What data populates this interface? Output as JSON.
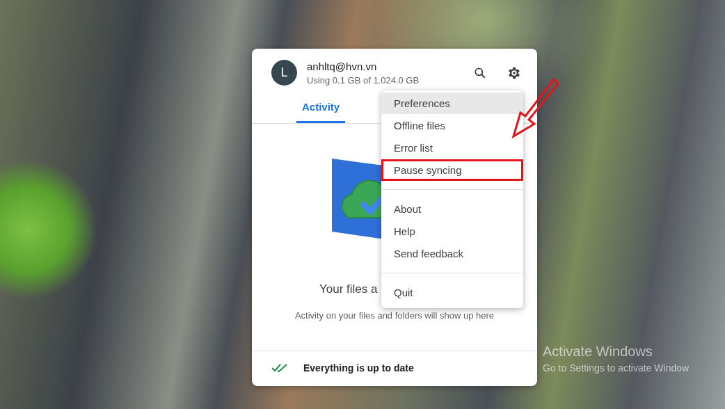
{
  "account": {
    "avatar_letter": "L",
    "email": "anhltq@hvn.vn",
    "storage": "Using 0.1 GB of 1.024.0 GB"
  },
  "tabs": [
    {
      "label": "Activity",
      "selected": true
    }
  ],
  "empty_state": {
    "title": "Your files a",
    "message": "Activity on your files and folders will show up here"
  },
  "status_bar": {
    "text": "Everything is up to date"
  },
  "menu": {
    "groups": [
      [
        {
          "label": "Preferences",
          "hovered": true,
          "annotated": false
        },
        {
          "label": "Offline files",
          "hovered": false,
          "annotated": false
        },
        {
          "label": "Error list",
          "hovered": false,
          "annotated": false
        },
        {
          "label": "Pause syncing",
          "hovered": false,
          "annotated": true
        }
      ],
      [
        {
          "label": "About",
          "hovered": false,
          "annotated": false
        },
        {
          "label": "Help",
          "hovered": false,
          "annotated": false
        },
        {
          "label": "Send feedback",
          "hovered": false,
          "annotated": false
        }
      ],
      [
        {
          "label": "Quit",
          "hovered": false,
          "annotated": false
        }
      ]
    ]
  },
  "activation_notice": {
    "title": "Activate Windows",
    "message": "Go to Settings to activate Window"
  }
}
